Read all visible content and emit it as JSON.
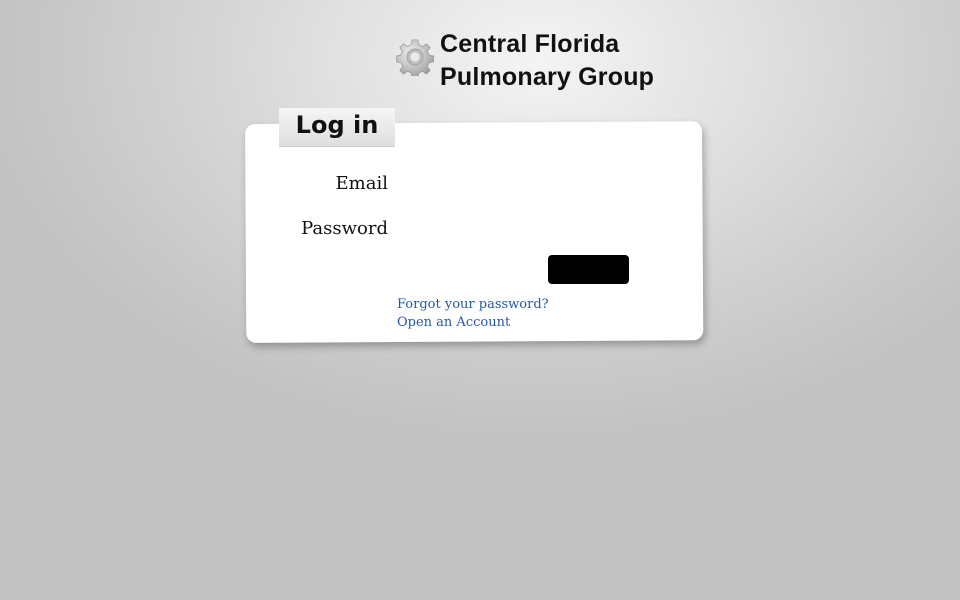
{
  "brand": {
    "line1": "Central Florida",
    "line2": "Pulmonary Group",
    "logo_icon": "gear-icon"
  },
  "login": {
    "title": "Log in",
    "email_label": "Email",
    "email_value": "",
    "password_label": "Password",
    "password_value": "",
    "submit_label": "",
    "forgot_link": "Forgot your password?",
    "open_account_link": "Open an Account"
  },
  "colors": {
    "link": "#2458a8",
    "button": "#000000",
    "card": "#ffffff"
  }
}
